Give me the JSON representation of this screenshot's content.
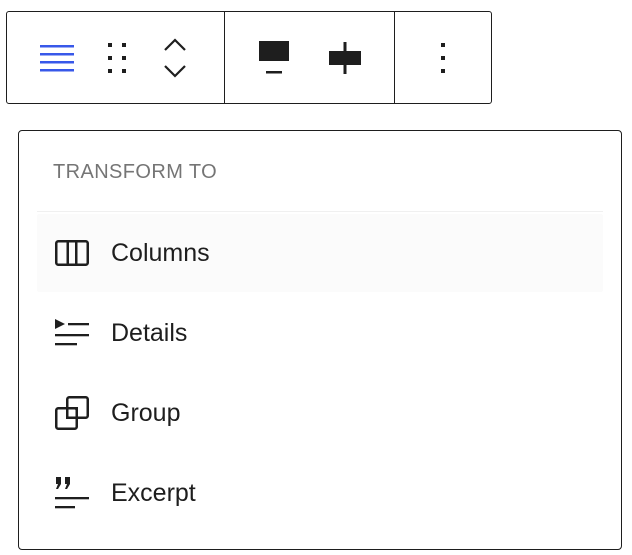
{
  "toolbar": {
    "groups": [
      {
        "buttons": [
          {
            "icon": "align-justify-icon",
            "active_color": "#3858e9"
          },
          {
            "icon": "drag-handle-icon"
          },
          {
            "icon": "move-up-down-icon"
          }
        ]
      },
      {
        "buttons": [
          {
            "icon": "justify-top-icon"
          },
          {
            "icon": "justify-center-icon"
          }
        ]
      },
      {
        "buttons": [
          {
            "icon": "more-options-icon"
          }
        ]
      }
    ]
  },
  "popover": {
    "header": "TRANSFORM TO",
    "items": [
      {
        "label": "Columns",
        "icon": "columns-icon"
      },
      {
        "label": "Details",
        "icon": "details-icon"
      },
      {
        "label": "Group",
        "icon": "group-icon"
      },
      {
        "label": "Excerpt",
        "icon": "excerpt-icon"
      }
    ]
  },
  "colors": {
    "accent": "#3858e9",
    "text": "#1e1e1e",
    "muted": "#757575",
    "border": "#1e1e1e"
  }
}
